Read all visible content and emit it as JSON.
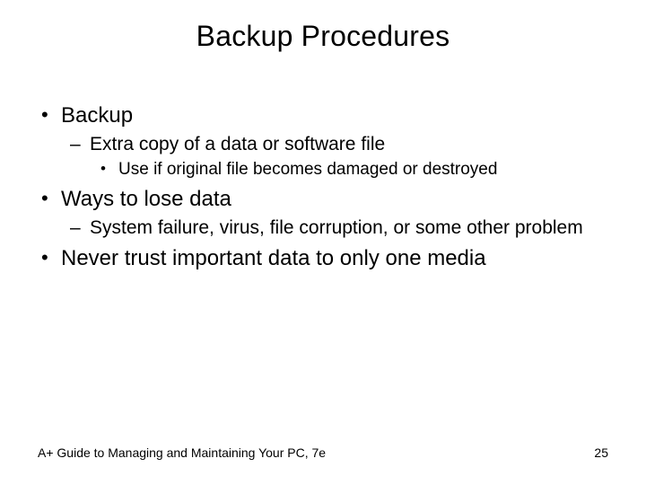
{
  "slide": {
    "title": "Backup Procedures",
    "bullets": {
      "b1": "Backup",
      "b1_1": "Extra copy of a data or software file",
      "b1_1_1": "Use if original file becomes damaged or destroyed",
      "b2": "Ways to lose data",
      "b2_1": "System failure, virus, file corruption, or some other problem",
      "b3": "Never trust important data to only one media"
    },
    "footer": {
      "source": "A+ Guide to Managing and Maintaining Your PC, 7e",
      "page": "25"
    }
  }
}
